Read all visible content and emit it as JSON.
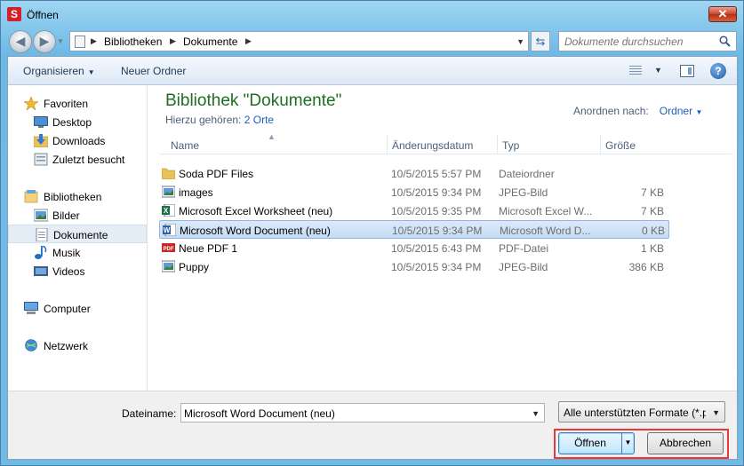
{
  "window": {
    "title": "Öffnen",
    "app_icon_letter": "S",
    "close_symbol": "✕"
  },
  "nav": {
    "back_symbol": "◀",
    "forward_symbol": "▶",
    "breadcrumb": [
      "Bibliotheken",
      "Dokumente"
    ],
    "search_placeholder": "Dokumente durchsuchen"
  },
  "toolbar": {
    "organize_label": "Organisieren",
    "new_folder_label": "Neuer Ordner",
    "help_symbol": "?"
  },
  "sidebar": {
    "items": [
      {
        "label": "Favoriten",
        "icon": "star-icon",
        "group": true
      },
      {
        "label": "Desktop",
        "icon": "desktop-icon"
      },
      {
        "label": "Downloads",
        "icon": "downloads-icon"
      },
      {
        "label": "Zuletzt besucht",
        "icon": "recent-places-icon"
      },
      {
        "label": "Bibliotheken",
        "icon": "libraries-icon",
        "group": true
      },
      {
        "label": "Bilder",
        "icon": "pictures-icon"
      },
      {
        "label": "Dokumente",
        "icon": "documents-icon",
        "selected": true
      },
      {
        "label": "Musik",
        "icon": "music-icon"
      },
      {
        "label": "Videos",
        "icon": "videos-icon"
      },
      {
        "label": "Computer",
        "icon": "computer-icon",
        "group": true
      },
      {
        "label": "Netzwerk",
        "icon": "network-icon",
        "group": true
      }
    ]
  },
  "library": {
    "title": "Bibliothek \"Dokumente\"",
    "subtitle_prefix": "Hierzu gehören:",
    "subtitle_link": "2 Orte",
    "arrange_label": "Anordnen nach:",
    "arrange_value": "Ordner"
  },
  "columns": {
    "name": "Name",
    "date": "Änderungsdatum",
    "type": "Typ",
    "size": "Größe"
  },
  "files": [
    {
      "name": "Soda PDF Files",
      "date": "10/5/2015 5:57 PM",
      "type": "Dateiordner",
      "size": "",
      "icon": "folder-icon"
    },
    {
      "name": "images",
      "date": "10/5/2015 9:34 PM",
      "type": "JPEG-Bild",
      "size": "7 KB",
      "icon": "image-icon"
    },
    {
      "name": "Microsoft Excel Worksheet (neu)",
      "date": "10/5/2015 9:35 PM",
      "type": "Microsoft Excel W...",
      "size": "7 KB",
      "icon": "excel-icon"
    },
    {
      "name": "Microsoft Word Document (neu)",
      "date": "10/5/2015 9:34 PM",
      "type": "Microsoft Word D...",
      "size": "0 KB",
      "icon": "word-icon",
      "selected": true
    },
    {
      "name": "Neue PDF 1",
      "date": "10/5/2015 6:43 PM",
      "type": "PDF-Datei",
      "size": "1 KB",
      "icon": "pdf-icon"
    },
    {
      "name": "Puppy",
      "date": "10/5/2015 9:34 PM",
      "type": "JPEG-Bild",
      "size": "386 KB",
      "icon": "image-icon"
    }
  ],
  "footer": {
    "filename_label": "Dateiname:",
    "filename_value": "Microsoft Word Document (neu)",
    "filter_value": "Alle unterstützten Formate (*.pdf",
    "open_label": "Öffnen",
    "cancel_label": "Abbrechen"
  },
  "colors": {
    "title_green": "#1e6e21",
    "link_blue": "#1c5ec0",
    "highlight_red": "#e5393b"
  }
}
